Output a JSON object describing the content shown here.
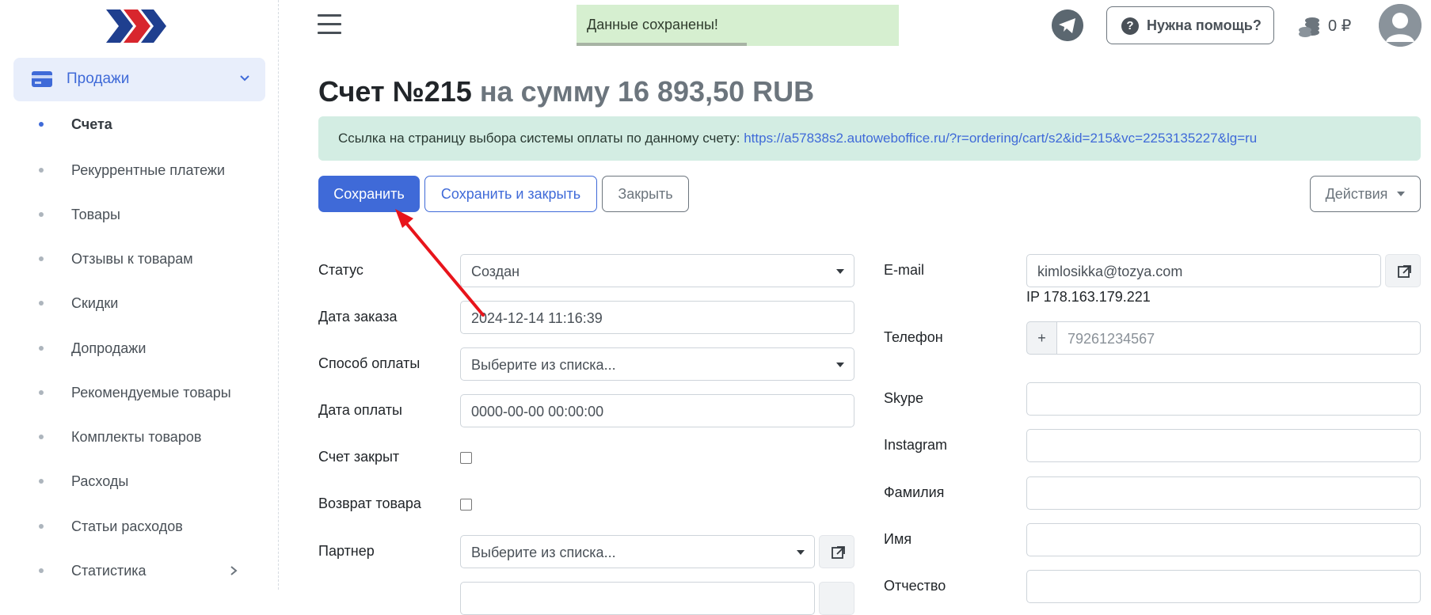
{
  "sidebar": {
    "main_label": "Продажи",
    "items": [
      {
        "label": "Счета",
        "active": true
      },
      {
        "label": "Рекуррентные платежи"
      },
      {
        "label": "Товары"
      },
      {
        "label": "Отзывы к товарам"
      },
      {
        "label": "Скидки"
      },
      {
        "label": "Допродажи"
      },
      {
        "label": "Рекомендуемые товары"
      },
      {
        "label": "Комплекты товаров"
      },
      {
        "label": "Расходы"
      },
      {
        "label": "Статьи расходов"
      },
      {
        "label": "Статистика"
      }
    ]
  },
  "header": {
    "toast": "Данные сохранены!",
    "help_label": "Нужна помощь?",
    "balance": "0 ₽"
  },
  "page": {
    "title_main": "Счет №215",
    "title_sub": " на сумму 16 893,50 RUB",
    "alert_text": "Ссылка на страницу выбора системы оплаты по данному счету: ",
    "alert_link": "https://a57838s2.autoweboffice.ru/?r=ordering/cart/s2&id=215&vc=2253135227&lg=ru"
  },
  "toolbar": {
    "save": "Сохранить",
    "save_close": "Сохранить и закрыть",
    "close": "Закрыть",
    "actions": "Действия"
  },
  "form_left": {
    "status_label": "Статус",
    "status_value": "Создан",
    "order_date_label": "Дата заказа",
    "order_date_value": "2024-12-14 11:16:39",
    "payment_method_label": "Способ оплаты",
    "payment_method_value": "Выберите из списка...",
    "payment_date_label": "Дата оплаты",
    "payment_date_value": "0000-00-00 00:00:00",
    "closed_label": "Счет закрыт",
    "return_label": "Возврат товара",
    "partner_label": "Партнер",
    "partner_value": "Выберите из списка..."
  },
  "form_right": {
    "email_label": "E-mail",
    "email_value": "kimlosikka@tozya.com",
    "ip": "IP 178.163.179.221",
    "phone_label": "Телефон",
    "phone_prefix": "+",
    "phone_placeholder": "79261234567",
    "skype_label": "Skype",
    "instagram_label": "Instagram",
    "lastname_label": "Фамилия",
    "firstname_label": "Имя",
    "middlename_label": "Отчество"
  },
  "colors": {
    "primary": "#3f6ad8",
    "toast_bg": "#d6efd0",
    "alert_bg": "#d3ede3",
    "arrow": "#e8141b"
  }
}
